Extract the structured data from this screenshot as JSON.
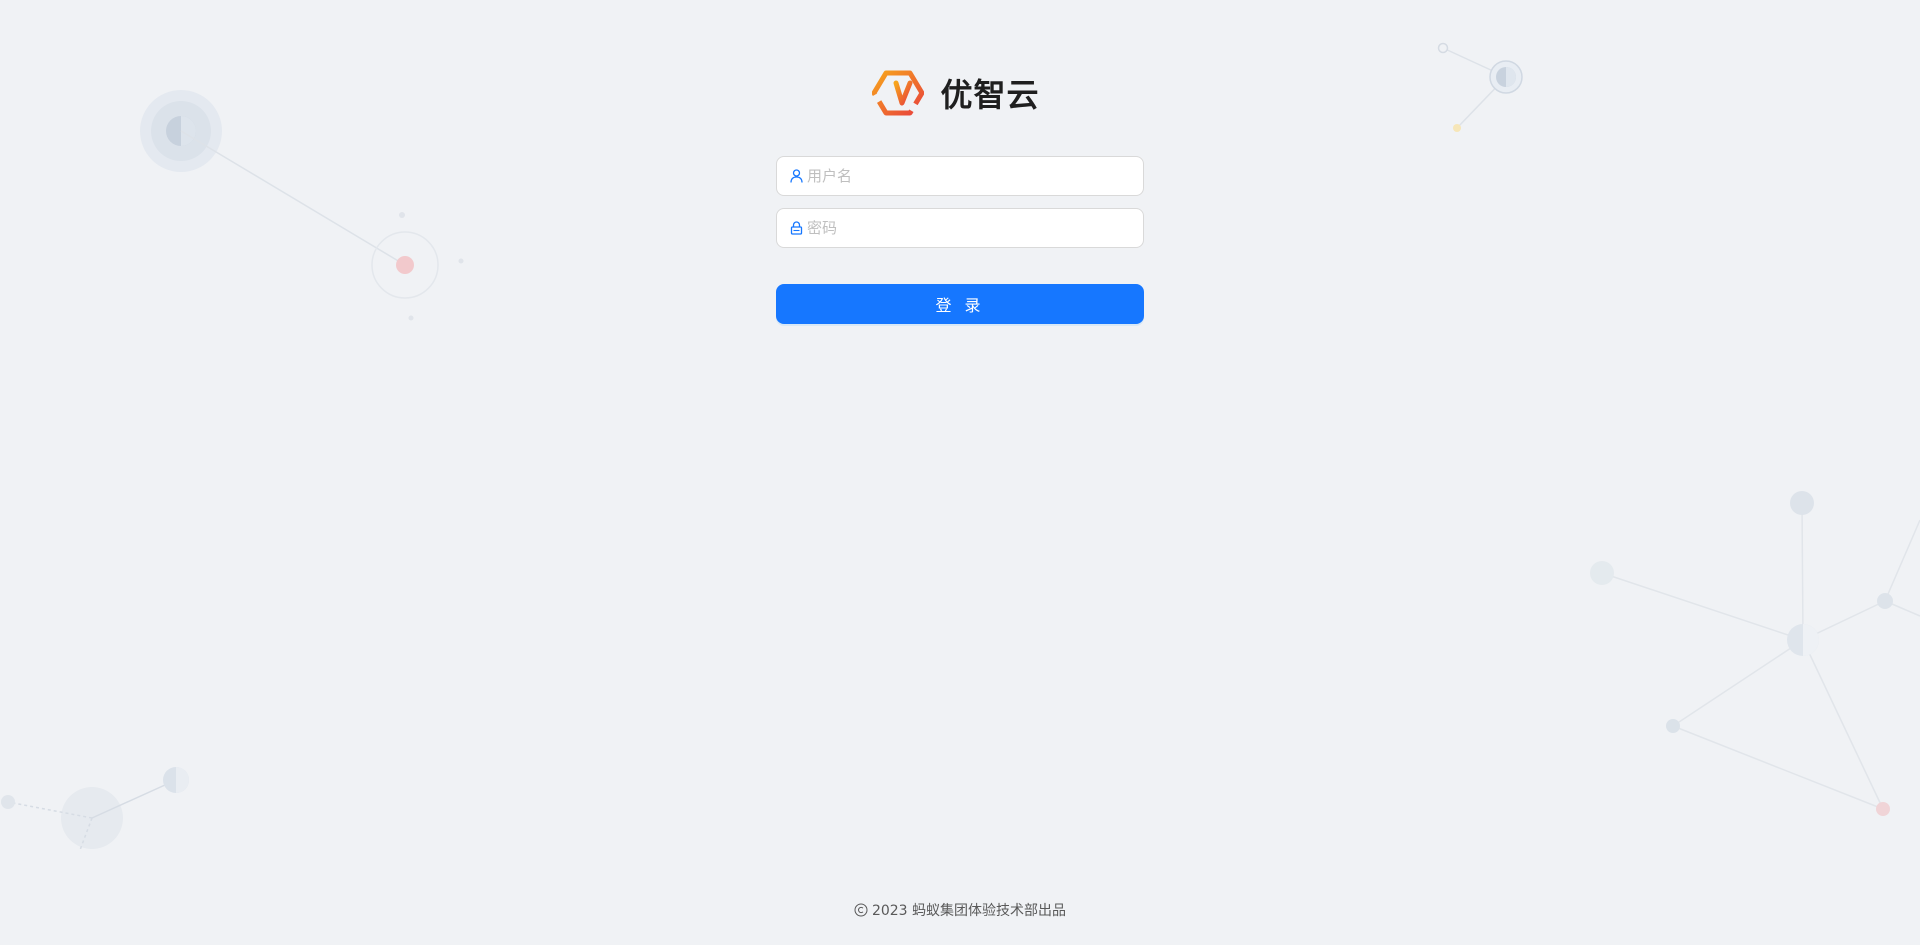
{
  "app": {
    "title": "优智云"
  },
  "login_form": {
    "username": {
      "placeholder": "用户名",
      "value": ""
    },
    "password": {
      "placeholder": "密码",
      "value": ""
    },
    "submit_label": "登 录"
  },
  "footer": {
    "text": "2023 蚂蚁集团体验技术部出品"
  },
  "icons": {
    "logo": "hexagon-logo-icon",
    "username_prefix": "user-icon",
    "password_prefix": "lock-icon",
    "footer_prefix": "copyright-icon"
  },
  "colors": {
    "background": "#f0f2f5",
    "primary": "#1677ff",
    "logo_gradient_start": "#f7a51c",
    "logo_gradient_end": "#e8413c",
    "title": "#1f1f1f",
    "placeholder": "#bfbfbf",
    "footer_text": "#595959"
  }
}
